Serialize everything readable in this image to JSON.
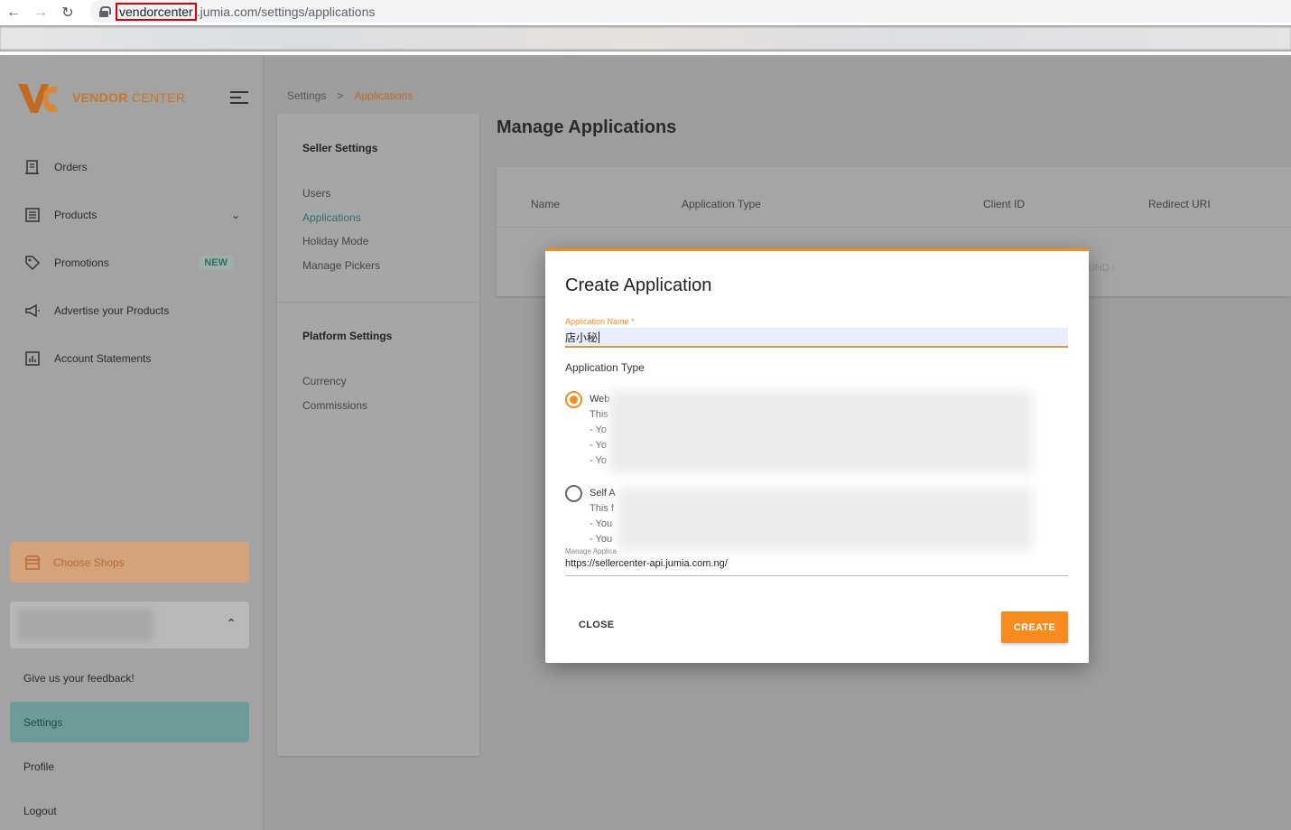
{
  "browser": {
    "url_highlighted": "vendorcenter",
    "url_rest": ".jumia.com/settings/applications"
  },
  "brand": {
    "logo_text_bold": "VENDOR ",
    "logo_text_rest": "CENTER",
    "accent_color": "#f68b1e"
  },
  "sidebar": {
    "items": [
      {
        "label": "Orders",
        "icon": "receipt-icon"
      },
      {
        "label": "Products",
        "icon": "list-icon"
      },
      {
        "label": "Promotions",
        "icon": "tag-icon",
        "badge": "NEW"
      },
      {
        "label": "Advertise your Products",
        "icon": "megaphone-icon"
      },
      {
        "label": "Account Statements",
        "icon": "chart-icon"
      }
    ],
    "choose_shops": "Choose Shops",
    "feedback": "Give us your feedback!",
    "settings": "Settings",
    "profile": "Profile",
    "logout": "Logout"
  },
  "breadcrumb": {
    "parent": "Settings",
    "separator": ">",
    "current": "Applications"
  },
  "settings_menu": {
    "seller_heading": "Seller Settings",
    "seller_items": [
      "Users",
      "Applications",
      "Holiday Mode",
      "Manage Pickers"
    ],
    "platform_heading": "Platform Settings",
    "platform_items": [
      "Currency",
      "Commissions"
    ]
  },
  "main": {
    "title": "Manage Applications",
    "columns": [
      "Name",
      "Application Type",
      "Client ID",
      "Redirect URI"
    ],
    "no_data_fragment": "UND !"
  },
  "modal": {
    "title": "Create Application",
    "name_label": "Application Name *",
    "name_value": "店小秘",
    "type_label": "Application Type",
    "option1_title": "Web",
    "option1_lines": [
      "This",
      "- Yo",
      "- Yo",
      "- Yo"
    ],
    "option2_title": "Self A",
    "option2_lines": [
      "This f",
      "- You",
      "- You"
    ],
    "uri_label": "Manage Applica",
    "uri_value": "https://sellercenter-api.jumia.com.ng/",
    "close_label": "CLOSE",
    "create_label": "CREATE"
  }
}
